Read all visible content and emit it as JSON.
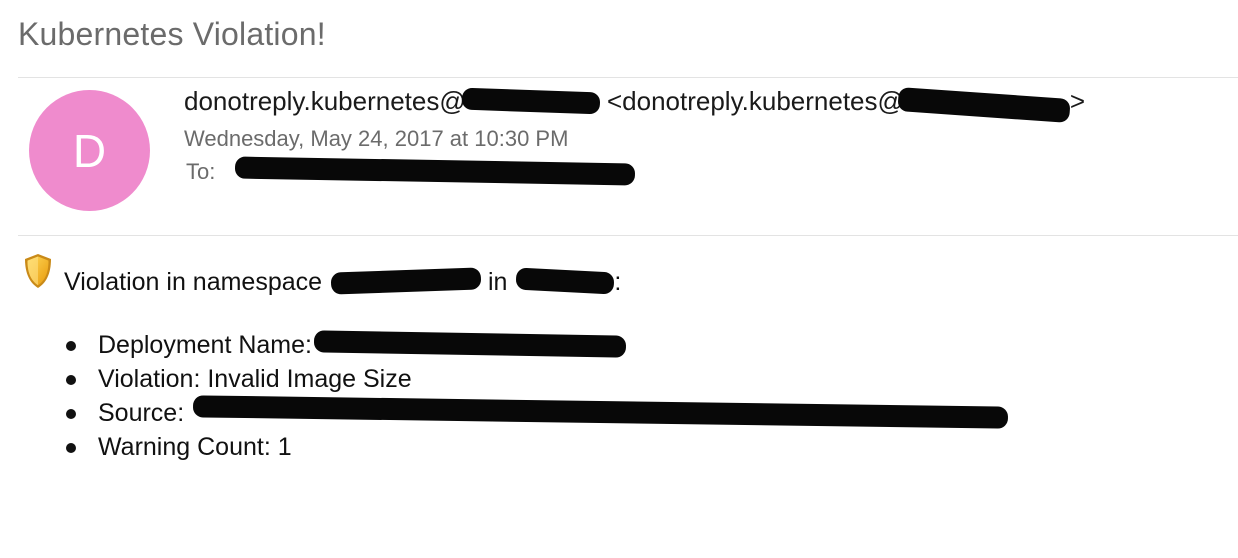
{
  "email": {
    "subject": "Kubernetes Violation!",
    "avatar_initial": "D",
    "avatar_color": "#ef8bcd",
    "from_name_visible": "donotreply.kubernetes@",
    "from_open_bracket": "<donotreply.kubernetes@",
    "from_close_bracket": ">",
    "date": "Wednesday, May 24, 2017 at 10:30 PM",
    "to_label": "To:",
    "body": {
      "shield_icon_color": "#f2b015",
      "violation_prefix": "Violation in namespace",
      "violation_mid": "in",
      "violation_suffix": ":",
      "items": [
        {
          "label": "Deployment Name:",
          "value": ""
        },
        {
          "label": "Violation:",
          "value": "Invalid Image Size"
        },
        {
          "label": "Source:",
          "value": ""
        },
        {
          "label": "Warning Count:",
          "value": "1"
        }
      ]
    }
  }
}
